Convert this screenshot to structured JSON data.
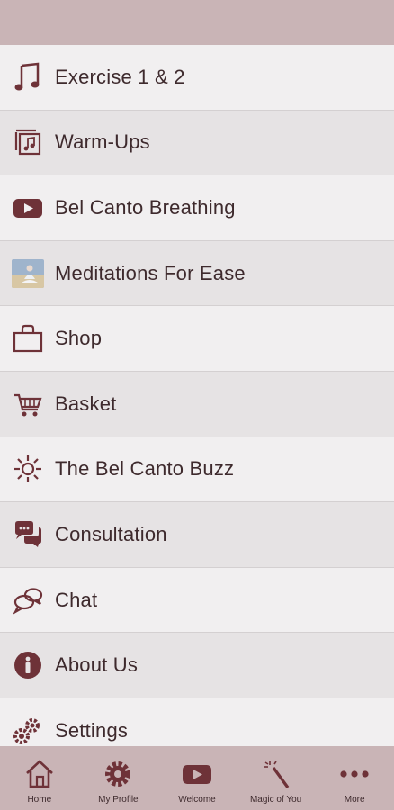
{
  "colors": {
    "accent": "#6e3238",
    "bars": "#c9b4b6",
    "row_alt": "#e6e3e4",
    "row_light": "#f1eff0"
  },
  "menu": {
    "items": [
      {
        "label": "Exercise 1 & 2",
        "icon": "music-note-icon"
      },
      {
        "label": "Warm-Ups",
        "icon": "music-library-icon"
      },
      {
        "label": "Bel Canto Breathing",
        "icon": "youtube-icon"
      },
      {
        "label": "Meditations For Ease",
        "icon": "meditation-thumbnail"
      },
      {
        "label": "Shop",
        "icon": "shopping-bag-icon"
      },
      {
        "label": "Basket",
        "icon": "cart-icon"
      },
      {
        "label": "The Bel Canto Buzz",
        "icon": "sun-icon"
      },
      {
        "label": "Consultation",
        "icon": "chat-bubbles-icon"
      },
      {
        "label": "Chat",
        "icon": "chat-outline-icon"
      },
      {
        "label": "About Us",
        "icon": "info-icon"
      },
      {
        "label": "Settings",
        "icon": "gears-icon"
      }
    ]
  },
  "tabbar": {
    "items": [
      {
        "label": "Home",
        "icon": "home-icon"
      },
      {
        "label": "My Profile",
        "icon": "gear-icon"
      },
      {
        "label": "Welcome",
        "icon": "youtube-icon"
      },
      {
        "label": "Magic of You",
        "icon": "magic-wand-icon"
      },
      {
        "label": "More",
        "icon": "more-dots-icon"
      }
    ]
  }
}
